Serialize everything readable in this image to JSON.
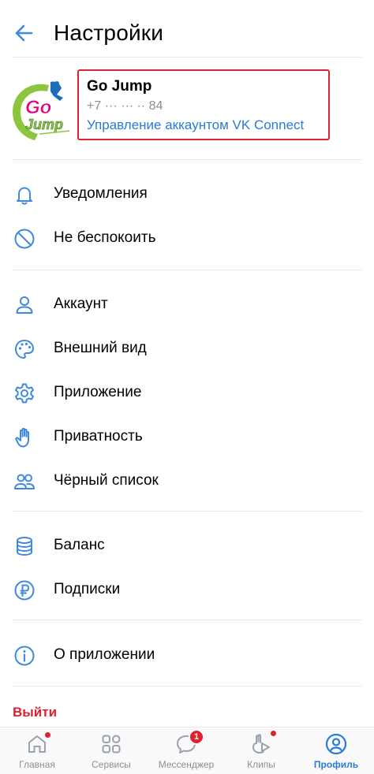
{
  "header": {
    "title": "Настройки"
  },
  "profile": {
    "name": "Go Jump",
    "phone": "+7 ··· ··· ·· 84",
    "manage_link": "Управление аккаунтом VK Connect",
    "avatar_text_top": "Go",
    "avatar_text_bottom": "Jump"
  },
  "menu": {
    "notifications": "Уведомления",
    "dnd": "Не беспокоить",
    "account": "Аккаунт",
    "appearance": "Внешний вид",
    "application": "Приложение",
    "privacy": "Приватность",
    "blacklist": "Чёрный список",
    "balance": "Баланс",
    "subscriptions": "Подписки",
    "about": "О приложении"
  },
  "logout_label": "Выйти",
  "tabbar": {
    "home": "Главная",
    "services": "Сервисы",
    "messenger": "Мессенджер",
    "messenger_badge": "1",
    "clips": "Клипы",
    "profile": "Профиль"
  },
  "colors": {
    "accent": "#2a7bd6",
    "icon": "#3f8ae0",
    "danger": "#e0212e",
    "secondary_text": "#8a8f95",
    "inactive_icon": "#99a2ad"
  },
  "icons": {
    "back": "arrow-left-icon",
    "notifications": "bell-icon",
    "dnd": "block-icon",
    "account": "user-icon",
    "appearance": "palette-icon",
    "application": "gear-icon",
    "privacy": "hand-icon",
    "blacklist": "users-icon",
    "balance": "coins-icon",
    "subscriptions": "ruble-icon",
    "about": "info-icon"
  }
}
